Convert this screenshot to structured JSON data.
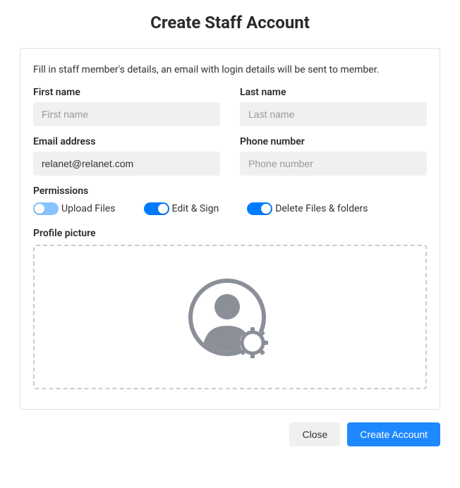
{
  "title": "Create Staff Account",
  "intro": "Fill in staff member's details, an email with login details will be sent to member.",
  "fields": {
    "first_name": {
      "label": "First name",
      "placeholder": "First name",
      "value": ""
    },
    "last_name": {
      "label": "Last name",
      "placeholder": "Last name",
      "value": ""
    },
    "email": {
      "label": "Email address",
      "placeholder": "",
      "value": "relanet@relanet.com"
    },
    "phone": {
      "label": "Phone number",
      "placeholder": "Phone number",
      "value": ""
    }
  },
  "permissions": {
    "label": "Permissions",
    "items": [
      {
        "label": "Upload Files",
        "enabled": false
      },
      {
        "label": "Edit & Sign",
        "enabled": true
      },
      {
        "label": "Delete Files & folders",
        "enabled": true
      }
    ]
  },
  "profile_picture": {
    "label": "Profile picture"
  },
  "actions": {
    "close": "Close",
    "create": "Create Account"
  },
  "colors": {
    "primary": "#1e88ff",
    "toggle_on": "#007bff",
    "toggle_off_light": "#88c3ff",
    "input_bg": "#f0f0f0",
    "border": "#e0e0e0"
  }
}
